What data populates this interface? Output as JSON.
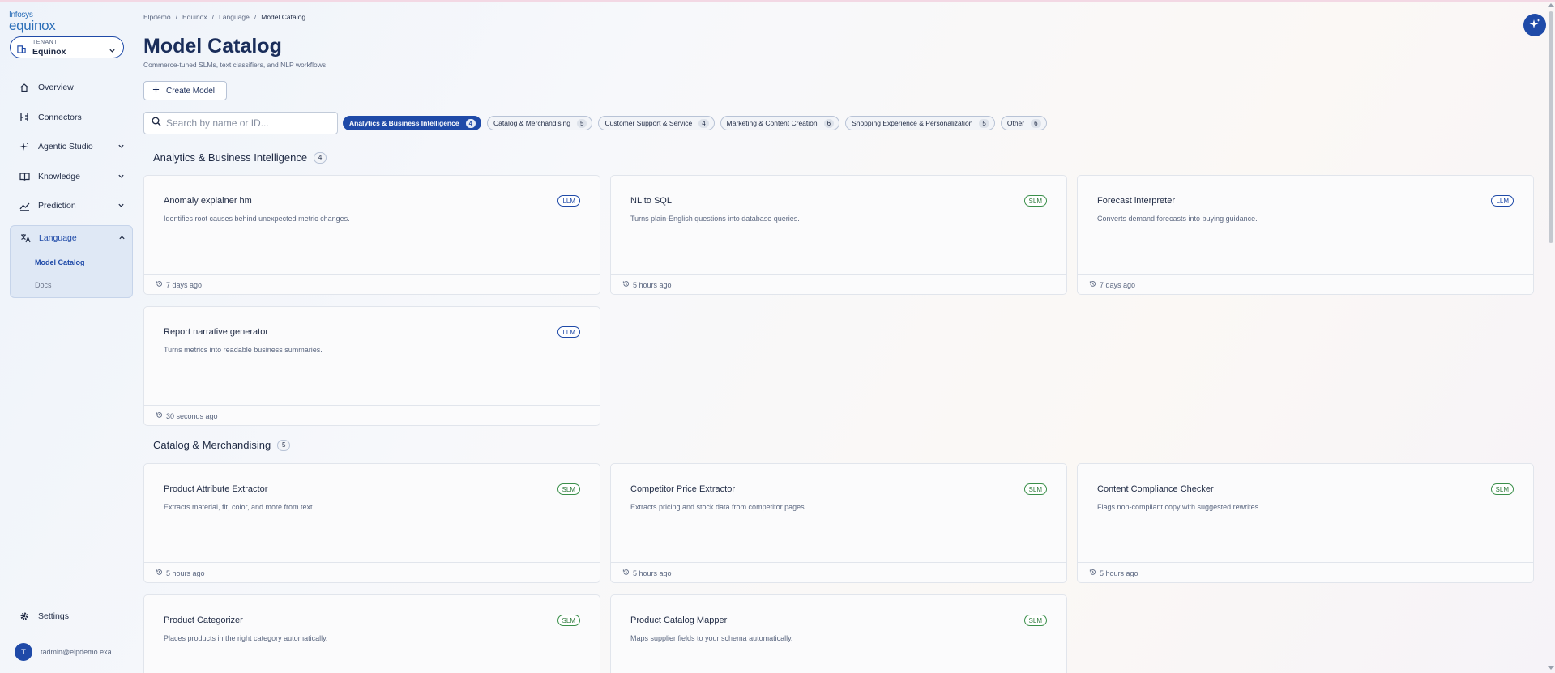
{
  "logo": {
    "line1": "Infosys",
    "line2": "equinox"
  },
  "tenant": {
    "caption": "TENANT",
    "name": "Equinox"
  },
  "nav": {
    "items": [
      {
        "label": "Overview",
        "icon": "home-icon"
      },
      {
        "label": "Connectors",
        "icon": "connectors-icon"
      },
      {
        "label": "Agentic Studio",
        "icon": "sparkle-icon"
      },
      {
        "label": "Knowledge",
        "icon": "book-icon"
      },
      {
        "label": "Prediction",
        "icon": "chart-line-icon"
      },
      {
        "label": "Language",
        "icon": "translate-icon"
      }
    ],
    "language_sub": [
      {
        "label": "Model Catalog"
      },
      {
        "label": "Docs"
      }
    ],
    "settings": "Settings"
  },
  "user": {
    "initial": "T",
    "email": "tadmin@elpdemo.exa..."
  },
  "breadcrumb": [
    "Elpdemo",
    "Equinox",
    "Language",
    "Model Catalog"
  ],
  "page": {
    "title": "Model Catalog",
    "subtitle": "Commerce-tuned SLMs, text classifiers, and NLP workflows",
    "create_label": "Create Model",
    "search_placeholder": "Search by name or ID..."
  },
  "chips": [
    {
      "label": "Analytics & Business Intelligence",
      "count": "4",
      "active": true
    },
    {
      "label": "Catalog & Merchandising",
      "count": "5"
    },
    {
      "label": "Customer Support & Service",
      "count": "4"
    },
    {
      "label": "Marketing & Content Creation",
      "count": "6"
    },
    {
      "label": "Shopping Experience & Personalization",
      "count": "5"
    },
    {
      "label": "Other",
      "count": "6"
    }
  ],
  "sections": [
    {
      "title": "Analytics & Business Intelligence",
      "count": "4",
      "cards": [
        {
          "title": "Anomaly explainer hm",
          "desc": "Identifies root causes behind unexpected metric changes.",
          "badge": "LLM",
          "time": "7 days ago"
        },
        {
          "title": "NL to SQL",
          "desc": "Turns plain-English questions into database queries.",
          "badge": "SLM",
          "time": "5 hours ago"
        },
        {
          "title": "Forecast interpreter",
          "desc": "Converts demand forecasts into buying guidance.",
          "badge": "LLM",
          "time": "7 days ago"
        },
        {
          "title": "Report narrative generator",
          "desc": "Turns metrics into readable business summaries.",
          "badge": "LLM",
          "time": "30 seconds ago"
        }
      ]
    },
    {
      "title": "Catalog & Merchandising",
      "count": "5",
      "cards": [
        {
          "title": "Product Attribute Extractor",
          "desc": "Extracts material, fit, color, and more from text.",
          "badge": "SLM",
          "time": "5 hours ago"
        },
        {
          "title": "Competitor Price Extractor",
          "desc": "Extracts pricing and stock data from competitor pages.",
          "badge": "SLM",
          "time": "5 hours ago"
        },
        {
          "title": "Content Compliance Checker",
          "desc": "Flags non-compliant copy with suggested rewrites.",
          "badge": "SLM",
          "time": "5 hours ago"
        },
        {
          "title": "Product Categorizer",
          "desc": "Places products in the right category automatically.",
          "badge": "SLM",
          "time": ""
        },
        {
          "title": "Product Catalog Mapper",
          "desc": "Maps supplier fields to your schema automatically.",
          "badge": "SLM",
          "time": ""
        }
      ]
    }
  ],
  "colors": {
    "accent": "#1f4aa8",
    "llm": "#1f4aa8",
    "slm": "#2e7a3c"
  }
}
